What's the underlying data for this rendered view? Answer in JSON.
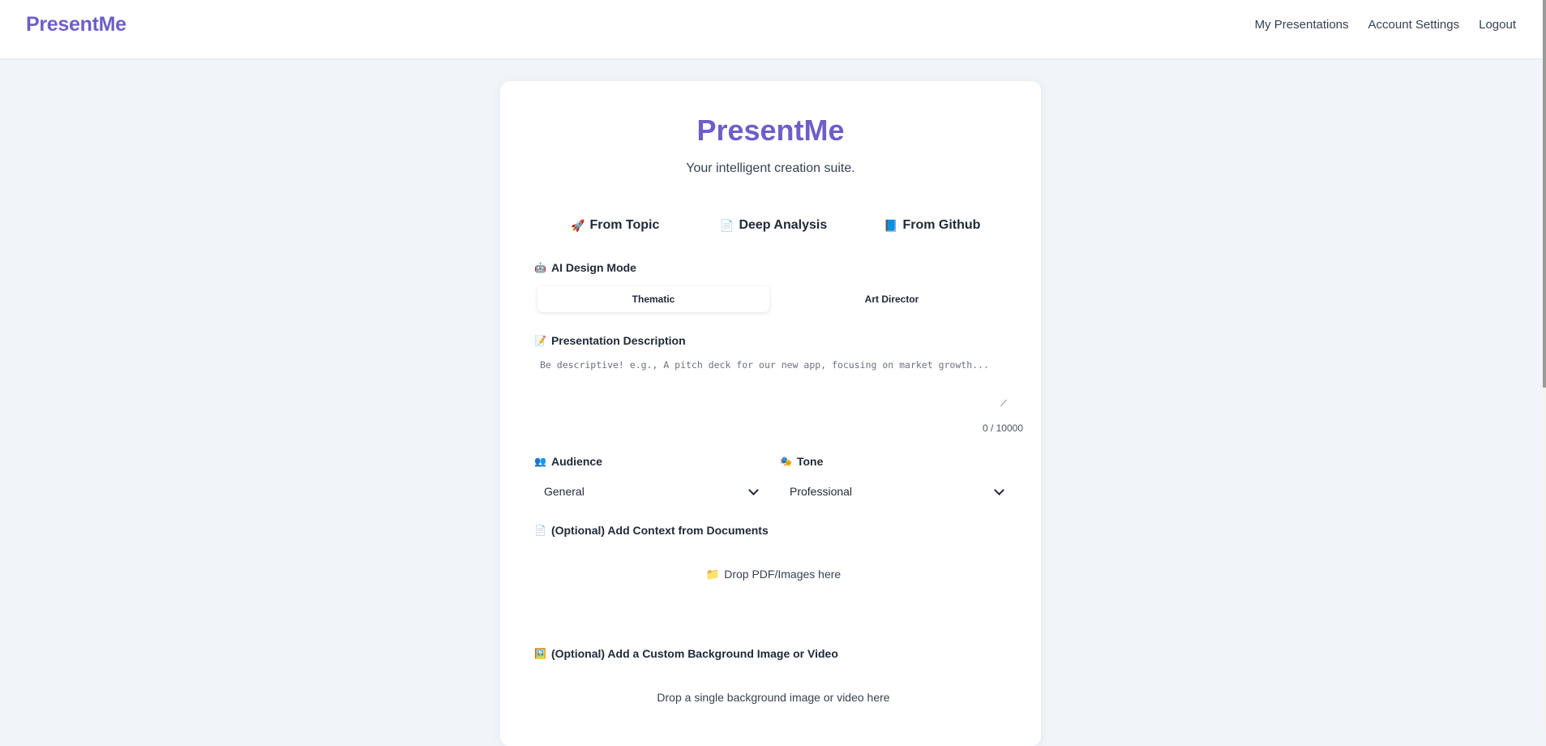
{
  "header": {
    "logo": "PresentMe",
    "nav": [
      "My Presentations",
      "Account Settings",
      "Logout"
    ]
  },
  "card": {
    "title": "PresentMe",
    "subtitle": "Your intelligent creation suite.",
    "tabs": [
      {
        "icon": "🚀",
        "label": "From Topic"
      },
      {
        "icon": "📄",
        "label": "Deep Analysis"
      },
      {
        "icon": "📘",
        "label": "From Github"
      }
    ],
    "design_mode": {
      "icon": "🤖",
      "label": "AI Design Mode",
      "options": [
        "Thematic",
        "Art Director"
      ],
      "selected": "Thematic"
    },
    "description": {
      "icon": "📝",
      "label": "Presentation Description",
      "placeholder": "Be descriptive! e.g., A pitch deck for our new app, focusing on market growth...",
      "counter": "0 / 10000"
    },
    "audience": {
      "icon": "👥",
      "label": "Audience",
      "value": "General"
    },
    "tone": {
      "icon": "🎭",
      "label": "Tone",
      "value": "Professional"
    },
    "context_docs": {
      "icon": "📄",
      "label": "(Optional) Add Context from Documents",
      "drop_icon": "📁",
      "drop_text": "Drop PDF/Images here"
    },
    "background": {
      "icon": "🖼️",
      "label": "(Optional) Add a Custom Background Image or Video",
      "drop_text": "Drop a single background image or video here"
    }
  },
  "colors": {
    "brand": "#6d5fc7",
    "page_bg": "#f1f4f8"
  }
}
